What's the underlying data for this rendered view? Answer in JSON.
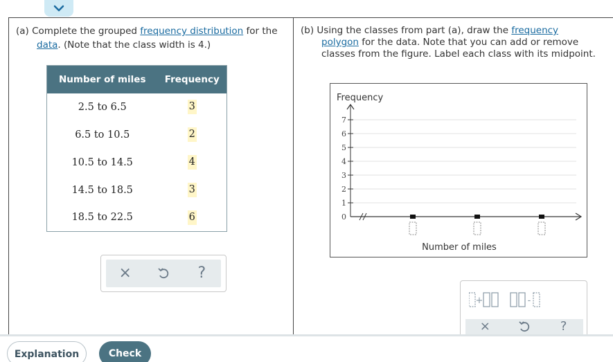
{
  "part_a": {
    "label": "(a)",
    "text_1": "Complete the grouped",
    "link_1": "frequency distribution",
    "text_2": "for the",
    "link_2": "data",
    "text_3": ". (Note that the class width is 4.)",
    "table": {
      "headers": [
        "Number of miles",
        "Frequency"
      ],
      "rows": [
        {
          "class": "2.5 to 6.5",
          "frequency": "3"
        },
        {
          "class": "6.5 to 10.5",
          "frequency": "2"
        },
        {
          "class": "10.5 to 14.5",
          "frequency": "4"
        },
        {
          "class": "14.5 to 18.5",
          "frequency": "3"
        },
        {
          "class": "18.5 to 22.5",
          "frequency": "6"
        }
      ]
    },
    "tools": {
      "clear": "×",
      "help": "?"
    }
  },
  "part_b": {
    "label": "(b)",
    "text_1": "Using the classes from part (a), draw the",
    "link_1": "frequency polygon",
    "text_2": "for the data. Note that you can add or remove classes from the figure. Label each class with its midpoint.",
    "graph": {
      "y_label": "Frequency",
      "x_label": "Number of miles",
      "y_ticks": [
        "0",
        "1",
        "2",
        "3",
        "4",
        "5",
        "6",
        "7"
      ]
    }
  },
  "chart_data": {
    "type": "line",
    "ylabel": "Frequency",
    "xlabel": "Number of miles",
    "ylim": [
      0,
      7
    ],
    "grid": true,
    "series": [
      {
        "values": [
          0,
          0,
          0
        ]
      }
    ],
    "categories": [
      "",
      "",
      ""
    ]
  },
  "footer": {
    "explanation": "Explanation",
    "check": "Check"
  },
  "colors": {
    "header_bg": "#4b7382",
    "link": "#1a6ba0",
    "answer_highlight": "#fff6c8"
  }
}
